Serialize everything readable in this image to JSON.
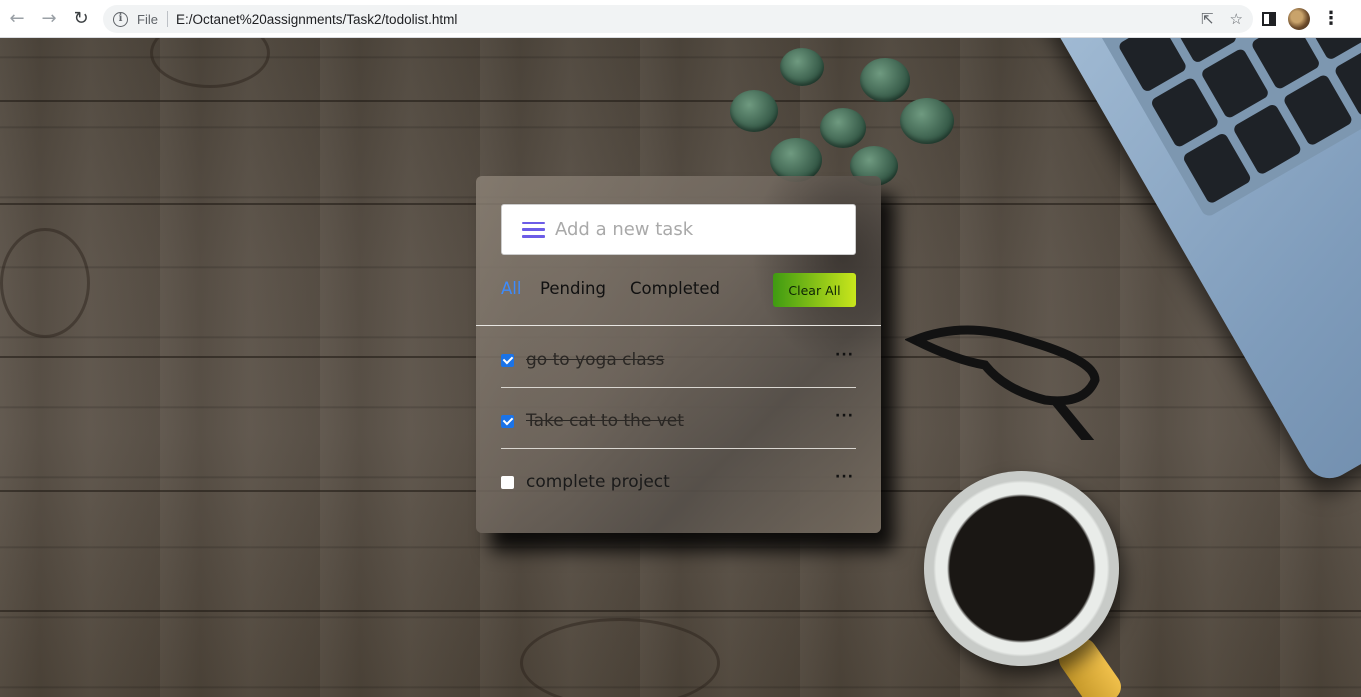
{
  "browser": {
    "nav": {
      "back_icon": "arrow-left-icon",
      "forward_icon": "arrow-right-icon",
      "reload_icon": "reload-icon"
    },
    "omnibox": {
      "info_icon": "info-icon",
      "scheme_label": "File",
      "url": "E:/Octanet%20assignments/Task2/todolist.html",
      "share_icon": "share-icon",
      "bookmark_icon": "star-icon"
    },
    "toolbar": {
      "side_panel_icon": "side-panel-icon",
      "profile_icon": "profile-avatar",
      "menu_icon": "kebab-menu-icon"
    }
  },
  "todo": {
    "input": {
      "placeholder": "Add a new task",
      "value": "",
      "icon": "menu-lines-icon",
      "icon_color": "#6c5ce7"
    },
    "filters": [
      {
        "label": "All",
        "active": true
      },
      {
        "label": "Pending",
        "active": false
      },
      {
        "label": "Completed",
        "active": false
      }
    ],
    "clear_button": {
      "label": "Clear All",
      "gradient": [
        "#3f9a12",
        "#c9e61c"
      ]
    },
    "tasks": [
      {
        "text": "go to yoga class",
        "completed": true
      },
      {
        "text": "Take cat to the vet",
        "completed": true
      },
      {
        "text": "complete project",
        "completed": false
      }
    ],
    "more_icon": "ellipsis-icon",
    "active_filter_color": "#3d8bfd"
  }
}
